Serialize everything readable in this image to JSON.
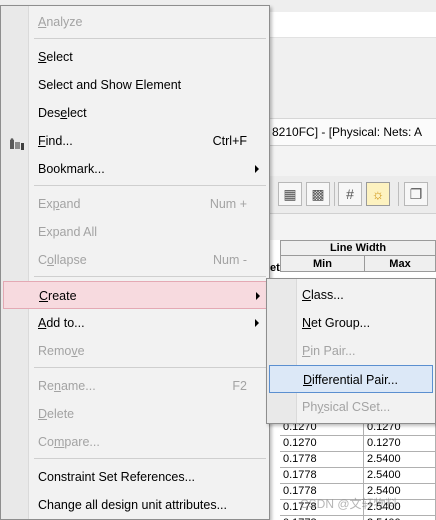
{
  "background": {
    "window_title": "8210FC] - [Physical:  Nets:  A",
    "toolbar_icons": [
      "cube-icon",
      "grid-icon",
      "hash-icon",
      "sun-icon",
      "copy-icon"
    ],
    "table": {
      "group_header": "Line Width",
      "col_min": "Min",
      "col_max": "Max",
      "left_partial": "et",
      "rows": [
        {
          "min": "0.1270",
          "max": "0.1270"
        },
        {
          "min": "0.1270",
          "max": "0.1270"
        },
        {
          "min": "0.1778",
          "max": "2.5400"
        },
        {
          "min": "0.1778",
          "max": "2.5400"
        },
        {
          "min": "0.1778",
          "max": "2.5400"
        },
        {
          "min": "0.1778",
          "max": "2.5400"
        },
        {
          "min": "0.1778",
          "max": "2.5400"
        }
      ]
    },
    "watermark": "CSDN @文轩物料"
  },
  "menu": {
    "items": [
      {
        "pre": "",
        "u": "A",
        "post": "nalyze",
        "shortcut": "",
        "submenu": false,
        "disabled": true
      },
      {
        "pre": "",
        "u": "S",
        "post": "elect",
        "shortcut": "",
        "submenu": false,
        "disabled": false
      },
      {
        "pre": "Select and Show Element",
        "u": "",
        "post": "",
        "shortcut": "",
        "submenu": false,
        "disabled": false
      },
      {
        "pre": "Des",
        "u": "e",
        "post": "lect",
        "shortcut": "",
        "submenu": false,
        "disabled": false
      },
      {
        "pre": "",
        "u": "F",
        "post": "ind...",
        "shortcut": "Ctrl+F",
        "submenu": false,
        "disabled": false
      },
      {
        "pre": "Bookmark...",
        "u": "",
        "post": "",
        "shortcut": "",
        "submenu": true,
        "disabled": false
      },
      {
        "pre": "Ex",
        "u": "p",
        "post": "and",
        "shortcut": "Num +",
        "submenu": false,
        "disabled": true
      },
      {
        "pre": "Expand All",
        "u": "",
        "post": "",
        "shortcut": "",
        "submenu": false,
        "disabled": true
      },
      {
        "pre": "C",
        "u": "o",
        "post": "llapse",
        "shortcut": "Num -",
        "submenu": false,
        "disabled": true
      },
      {
        "pre": "",
        "u": "C",
        "post": "reate",
        "shortcut": "",
        "submenu": true,
        "disabled": false
      },
      {
        "pre": "",
        "u": "A",
        "post": "dd to...",
        "shortcut": "",
        "submenu": true,
        "disabled": false
      },
      {
        "pre": "Remo",
        "u": "v",
        "post": "e",
        "shortcut": "",
        "submenu": false,
        "disabled": true
      },
      {
        "pre": "Re",
        "u": "n",
        "post": "ame...",
        "shortcut": "F2",
        "submenu": false,
        "disabled": true
      },
      {
        "pre": "",
        "u": "D",
        "post": "elete",
        "shortcut": "",
        "submenu": false,
        "disabled": true
      },
      {
        "pre": "Co",
        "u": "m",
        "post": "pare...",
        "shortcut": "",
        "submenu": false,
        "disabled": true
      },
      {
        "pre": "Constraint Set References...",
        "u": "",
        "post": "",
        "shortcut": "",
        "submenu": false,
        "disabled": false
      },
      {
        "pre": "Change all design unit attributes...",
        "u": "",
        "post": "",
        "shortcut": "",
        "submenu": false,
        "disabled": false
      }
    ]
  },
  "submenu": {
    "items": [
      {
        "pre": "",
        "u": "C",
        "post": "lass...",
        "disabled": false
      },
      {
        "pre": "",
        "u": "N",
        "post": "et Group...",
        "disabled": false
      },
      {
        "pre": "",
        "u": "P",
        "post": "in Pair...",
        "disabled": true
      },
      {
        "pre": "",
        "u": "D",
        "post": "ifferential Pair...",
        "disabled": false
      },
      {
        "pre": "Ph",
        "u": "y",
        "post": "sical CSet...",
        "disabled": true
      }
    ]
  }
}
